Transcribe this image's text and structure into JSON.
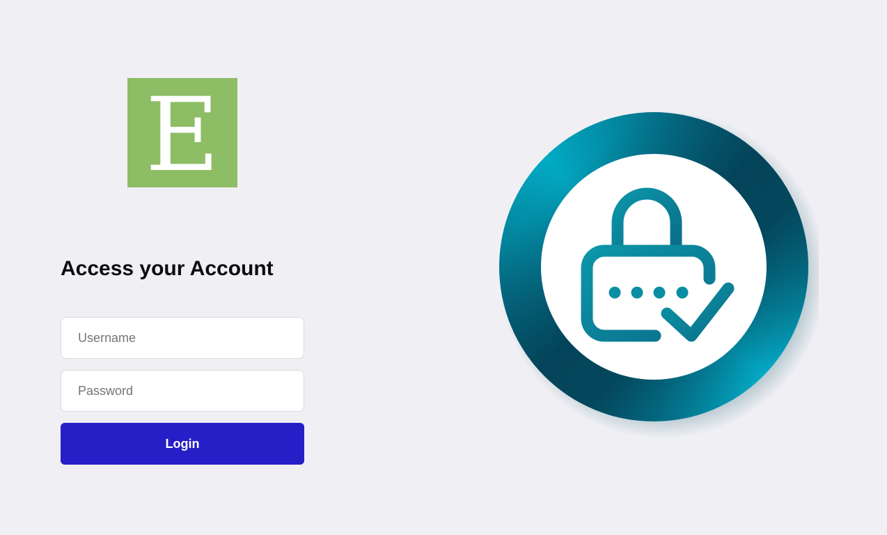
{
  "logo": {
    "letter": "E",
    "color": "#8dbd64"
  },
  "login": {
    "heading": "Access your Account",
    "username_placeholder": "Username",
    "password_placeholder": "Password",
    "button_label": "Login",
    "button_color": "#261fc7"
  },
  "illustration": {
    "icon": "lock-check-icon",
    "ring_colors": [
      "#00bcd6",
      "#04445a"
    ],
    "icon_color": "#0a8ea3"
  }
}
